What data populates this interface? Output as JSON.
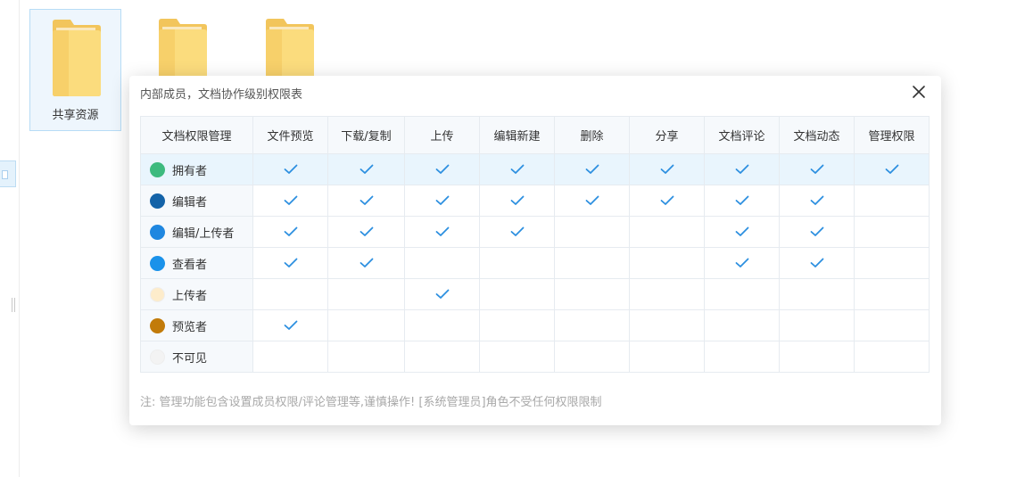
{
  "desktop": {
    "files": [
      {
        "label": "共享资源",
        "selected": true
      },
      {
        "label": "",
        "selected": false
      },
      {
        "label": "",
        "selected": false
      }
    ]
  },
  "modal": {
    "title": "内部成员，文档协作级别权限表",
    "note": "注: 管理功能包含设置成员权限/评论管理等,谨慎操作! [系统管理员]角色不受任何权限限制",
    "columns": [
      "文档权限管理",
      "文件预览",
      "下载/复制",
      "上传",
      "编辑新建",
      "删除",
      "分享",
      "文档评论",
      "文档动态",
      "管理权限"
    ],
    "rows": [
      {
        "name": "拥有者",
        "color": "#3dba7e",
        "perms": [
          true,
          true,
          true,
          true,
          true,
          true,
          true,
          true,
          true
        ]
      },
      {
        "name": "编辑者",
        "color": "#1463a8",
        "perms": [
          true,
          true,
          true,
          true,
          true,
          true,
          true,
          true,
          false
        ]
      },
      {
        "name": "编辑/上传者",
        "color": "#1f87e0",
        "perms": [
          true,
          true,
          true,
          true,
          false,
          false,
          true,
          true,
          false
        ]
      },
      {
        "name": "查看者",
        "color": "#1a92ea",
        "perms": [
          true,
          true,
          false,
          false,
          false,
          false,
          true,
          true,
          false
        ]
      },
      {
        "name": "上传者",
        "color": "#fdeccb",
        "perms": [
          false,
          false,
          true,
          false,
          false,
          false,
          false,
          false,
          false
        ]
      },
      {
        "name": "预览者",
        "color": "#c27b0a",
        "perms": [
          true,
          false,
          false,
          false,
          false,
          false,
          false,
          false,
          false
        ]
      },
      {
        "name": "不可见",
        "color": "#f3f3f3",
        "perms": [
          false,
          false,
          false,
          false,
          false,
          false,
          false,
          false,
          false
        ]
      }
    ]
  },
  "colors": {
    "check": "#2c8fe0",
    "highlight_row": "#e9f5fd",
    "header_bg": "#f6f9fc"
  },
  "icons": {
    "close": "close-icon",
    "check": "check-icon",
    "folder": "folder-icon"
  }
}
